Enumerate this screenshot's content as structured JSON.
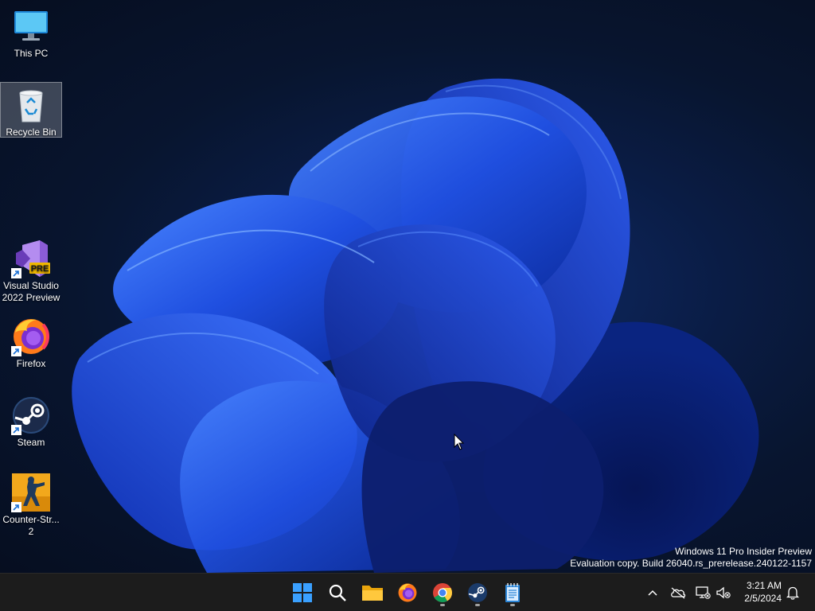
{
  "desktop": {
    "icons": [
      {
        "label": "This PC",
        "icon": "monitor-icon"
      },
      {
        "label": "Recycle Bin",
        "icon": "recycle-bin-icon",
        "selected": true
      },
      {
        "label": "Visual Studio 2022 Preview",
        "label_line1": "Visual Studio",
        "label_line2": "2022 Preview",
        "icon": "visual-studio-icon",
        "badge": "PRE"
      },
      {
        "label": "Firefox",
        "icon": "firefox-icon"
      },
      {
        "label": "Steam",
        "icon": "steam-icon"
      },
      {
        "label": "Counter-Str... 2",
        "label_line1": "Counter-Str...",
        "label_line2": "2",
        "icon": "counter-strike-icon"
      }
    ],
    "watermark": {
      "line1": "Windows 11 Pro Insider Preview",
      "line2": "Evaluation copy. Build 26040.rs_prerelease.240122-1157"
    }
  },
  "taskbar": {
    "pinned": [
      {
        "name": "Start",
        "icon": "windows-start-icon"
      },
      {
        "name": "Search",
        "icon": "search-icon"
      },
      {
        "name": "File Explorer",
        "icon": "folder-icon"
      },
      {
        "name": "Firefox",
        "icon": "firefox-icon"
      },
      {
        "name": "Google Chrome",
        "icon": "chrome-icon",
        "running": true
      },
      {
        "name": "Steam",
        "icon": "steam-icon",
        "running": true
      },
      {
        "name": "Notepad",
        "icon": "notepad-icon",
        "running": true
      }
    ],
    "tray": {
      "icons": [
        "chevron-up-icon",
        "onedrive-offline-icon",
        "network-disconnected-icon",
        "volume-muted-icon",
        "notification-bell-icon"
      ],
      "time": "3:21 AM",
      "date": "2/5/2024"
    }
  },
  "colors": {
    "taskbar_bg": "#1c1c1c",
    "wallpaper_accent": "#1f4fe0",
    "desktop_bg": "#08152f"
  }
}
